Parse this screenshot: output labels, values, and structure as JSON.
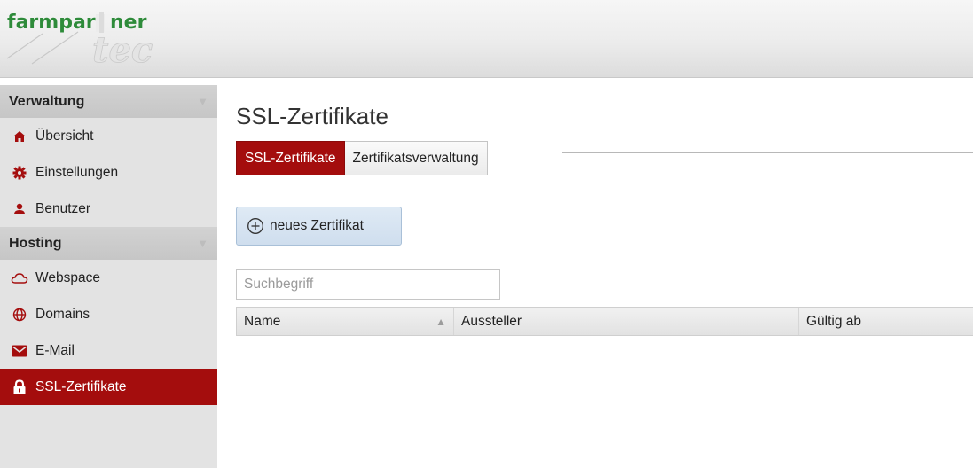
{
  "header": {
    "logo_primary": "farmpartner",
    "logo_secondary": "tec"
  },
  "sidebar": {
    "sections": [
      {
        "title": "Verwaltung",
        "items": [
          {
            "label": "Übersicht",
            "icon": "home-icon"
          },
          {
            "label": "Einstellungen",
            "icon": "gear-icon"
          },
          {
            "label": "Benutzer",
            "icon": "user-icon"
          }
        ]
      },
      {
        "title": "Hosting",
        "items": [
          {
            "label": "Webspace",
            "icon": "cloud-icon"
          },
          {
            "label": "Domains",
            "icon": "globe-icon"
          },
          {
            "label": "E-Mail",
            "icon": "mail-icon"
          },
          {
            "label": "SSL-Zertifikate",
            "icon": "lock-icon",
            "active": true
          }
        ]
      }
    ]
  },
  "main": {
    "title": "SSL-Zertifikate",
    "tabs": [
      {
        "label": "SSL-Zertifikate",
        "active": true
      },
      {
        "label": "Zertifikatsverwaltung",
        "active": false
      }
    ],
    "new_button_label": "neues Zertifikat",
    "search_placeholder": "Suchbegriff",
    "table": {
      "columns": [
        "Name",
        "Aussteller",
        "Gültig ab"
      ],
      "rows": []
    }
  },
  "colors": {
    "brand_green": "#2e8b3a",
    "active_red": "#a40d0d",
    "button_blue": "#cfdeee"
  }
}
